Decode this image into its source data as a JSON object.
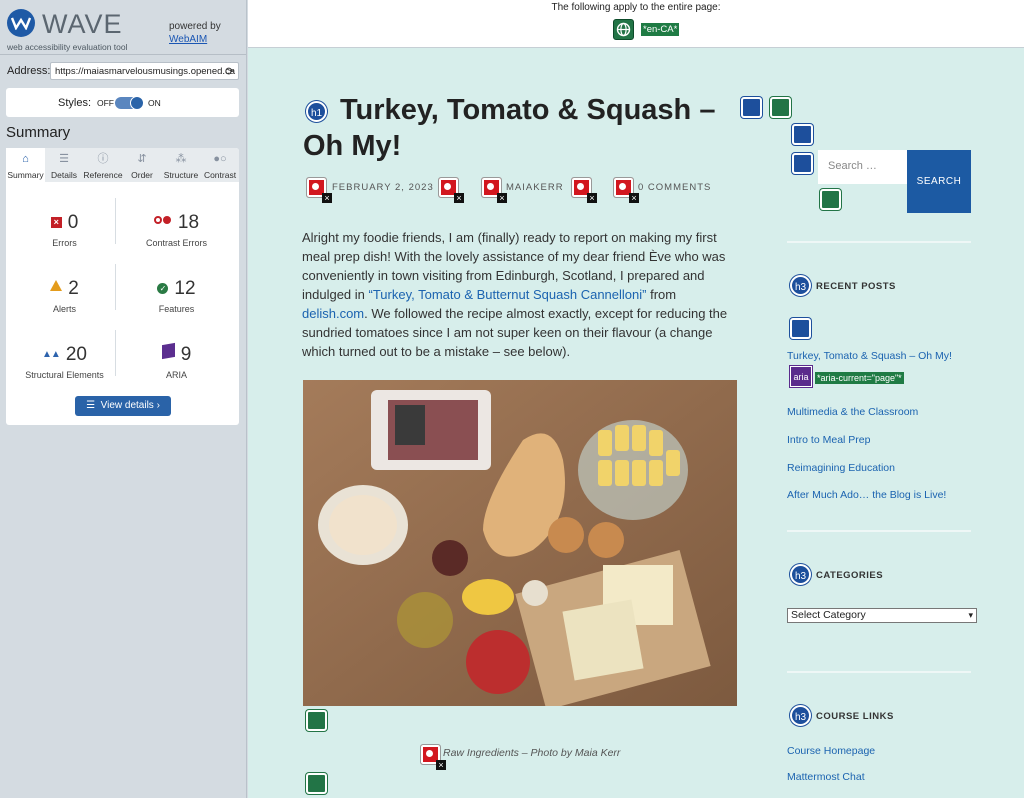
{
  "wave": {
    "brand": "WAVE",
    "tagline": "web accessibility evaluation tool",
    "powered_by": "powered by",
    "webaim": "WebAIM",
    "address_label": "Address:",
    "address_value": "https://maiasmarvelousmusings.opened.ca",
    "styles_label": "Styles:",
    "styles_off": "OFF",
    "styles_on": "ON",
    "summary_title": "Summary",
    "tabs": [
      {
        "label": "Summary"
      },
      {
        "label": "Details"
      },
      {
        "label": "Reference"
      },
      {
        "label": "Order"
      },
      {
        "label": "Structure"
      },
      {
        "label": "Contrast"
      }
    ],
    "stats": {
      "errors": {
        "count": "0",
        "label": "Errors"
      },
      "contrast": {
        "count": "18",
        "label": "Contrast Errors"
      },
      "alerts": {
        "count": "2",
        "label": "Alerts"
      },
      "features": {
        "count": "12",
        "label": "Features"
      },
      "structural": {
        "count": "20",
        "label": "Structural Elements"
      },
      "aria": {
        "count": "9",
        "label": "ARIA"
      }
    },
    "view_details": "View details ›"
  },
  "page": {
    "topbar_text": "The following apply to the entire page:",
    "lang_tag": "*en-CA*",
    "title": "Turkey, Tomato & Squash – Oh My!",
    "meta": {
      "date": "FEBRUARY 2, 2023",
      "author": "MAIAKERR",
      "comments": "0 COMMENTS"
    },
    "body": {
      "p1": "Alright my foodie friends, I am (finally) ready to report on making my first meal prep dish! With the lovely assistance of my dear friend Ève who was conveniently in town visiting from Edinburgh, Scotland, I prepared and indulged in ",
      "link1": "“Turkey, Tomato & Butternut Squash Cannelloni”",
      "p2": " from ",
      "link2": "delish.com",
      "p3": ". We followed the recipe almost exactly, except for reducing the sundried tomatoes since I am not super keen on their flavour (a change which turned out to be a mistake – see below)."
    },
    "caption": "Raw Ingredients – Photo by Maia Kerr",
    "search_placeholder": "Search …",
    "search_button": "SEARCH",
    "recent_posts_title": "RECENT POSTS",
    "recent_posts": [
      "Turkey, Tomato & Squash – Oh My!",
      "Multimedia & the Classroom",
      "Intro to Meal Prep",
      "Reimagining Education",
      "After Much Ado… the Blog is Live!"
    ],
    "aria_label": "aria",
    "aria_current": "*aria-current=\"page\"*",
    "categories_title": "CATEGORIES",
    "categories_select": "Select Category",
    "course_links_title": "COURSE LINKS",
    "course_links": [
      "Course Homepage",
      "Mattermost Chat"
    ],
    "h1_badge": "h1",
    "h3_badge": "h3"
  }
}
